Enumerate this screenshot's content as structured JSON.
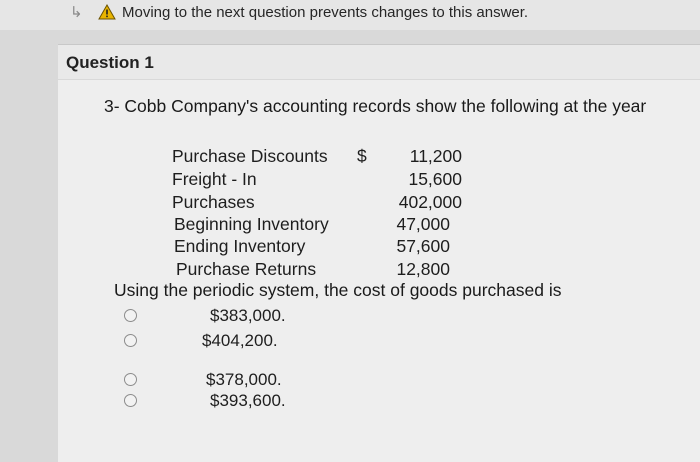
{
  "warning": {
    "text": "Moving to the next question prevents changes to this answer."
  },
  "question": {
    "title": "Question 1",
    "text": "3- Cobb Company's accounting records show the following at the year"
  },
  "records": [
    {
      "label": "Purchase Discounts",
      "currency": "$",
      "value": "11,200"
    },
    {
      "label": "Freight - In",
      "currency": "",
      "value": "15,600"
    },
    {
      "label": "Purchases",
      "currency": "",
      "value": "402,000"
    },
    {
      "label": "Beginning Inventory",
      "currency": "",
      "value": "47,000"
    },
    {
      "label": "Ending Inventory",
      "currency": "",
      "value": "57,600"
    },
    {
      "label": "Purchase Returns",
      "currency": "",
      "value": "12,800"
    }
  ],
  "prompt": "Using the periodic system, the cost of goods purchased is",
  "options": [
    {
      "label": "$383,000."
    },
    {
      "label": "$404,200."
    },
    {
      "label": "$378,000."
    },
    {
      "label": "$393,600."
    }
  ],
  "colors": {
    "warning_icon": "#e8b400",
    "background": "#eeeeee"
  }
}
